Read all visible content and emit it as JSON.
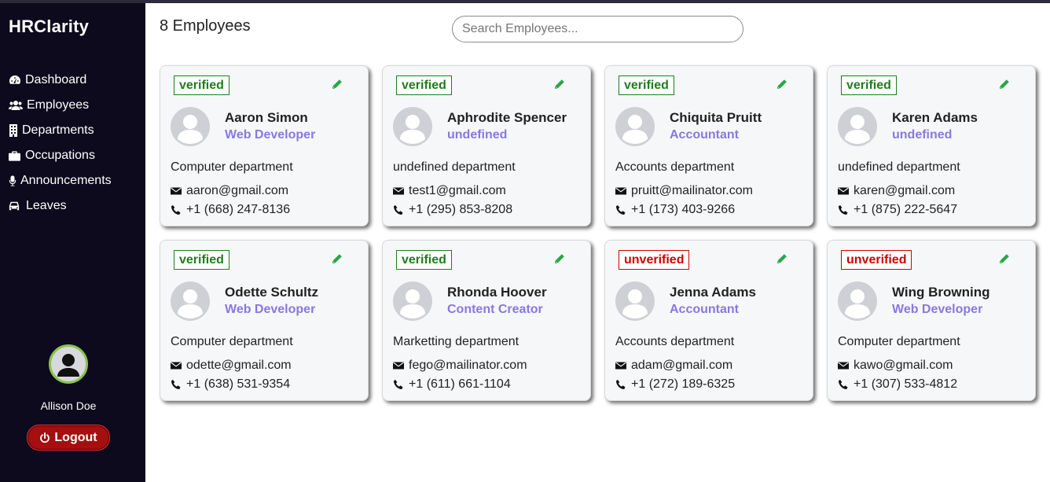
{
  "app": {
    "title": "HRClarity"
  },
  "sidebar": {
    "items": [
      {
        "label": "Dashboard",
        "icon": "tachometer-icon"
      },
      {
        "label": "Employees",
        "icon": "users-icon"
      },
      {
        "label": "Departments",
        "icon": "building-icon"
      },
      {
        "label": "Occupations",
        "icon": "briefcase-icon"
      },
      {
        "label": "Announcements",
        "icon": "microphone-icon"
      },
      {
        "label": "Leaves",
        "icon": "car-icon"
      }
    ],
    "user": {
      "name": "Allison Doe",
      "avatar_icon": "user-avatar-icon"
    },
    "logout_label": "Logout"
  },
  "main": {
    "count_title": "8 Employees",
    "search": {
      "placeholder": "Search Employees..."
    }
  },
  "colors": {
    "sidebar_bg": "#0c0a1c",
    "verified": "#1e7d1e",
    "unverified": "#d40000",
    "role": "#8a78e0",
    "edit_icon": "#28a745",
    "logout_bg": "#a50f0f"
  },
  "employees": [
    {
      "status": "verified",
      "name": "Aaron Simon",
      "role": "Web Developer",
      "department": "Computer department",
      "email": "aaron@gmail.com",
      "phone": "+1 (668) 247-8136"
    },
    {
      "status": "verified",
      "name": "Aphrodite Spencer",
      "role": "undefined",
      "department": "undefined department",
      "email": "test1@gmail.com",
      "phone": "+1 (295) 853-8208"
    },
    {
      "status": "verified",
      "name": "Chiquita Pruitt",
      "role": "Accountant",
      "department": "Accounts department",
      "email": "pruitt@mailinator.com",
      "phone": "+1 (173) 403-9266"
    },
    {
      "status": "verified",
      "name": "Karen Adams",
      "role": "undefined",
      "department": "undefined department",
      "email": "karen@gmail.com",
      "phone": "+1 (875) 222-5647"
    },
    {
      "status": "verified",
      "name": "Odette Schultz",
      "role": "Web Developer",
      "department": "Computer department",
      "email": "odette@gmail.com",
      "phone": "+1 (638) 531-9354"
    },
    {
      "status": "verified",
      "name": "Rhonda Hoover",
      "role": "Content Creator",
      "department": "Marketting department",
      "email": "fego@mailinator.com",
      "phone": "+1 (611) 661-1104"
    },
    {
      "status": "unverified",
      "name": "Jenna Adams",
      "role": "Accountant",
      "department": "Accounts department",
      "email": "adam@gmail.com",
      "phone": "+1 (272) 189-6325"
    },
    {
      "status": "unverified",
      "name": "Wing Browning",
      "role": "Web Developer",
      "department": "Computer department",
      "email": "kawo@gmail.com",
      "phone": "+1 (307) 533-4812"
    }
  ]
}
